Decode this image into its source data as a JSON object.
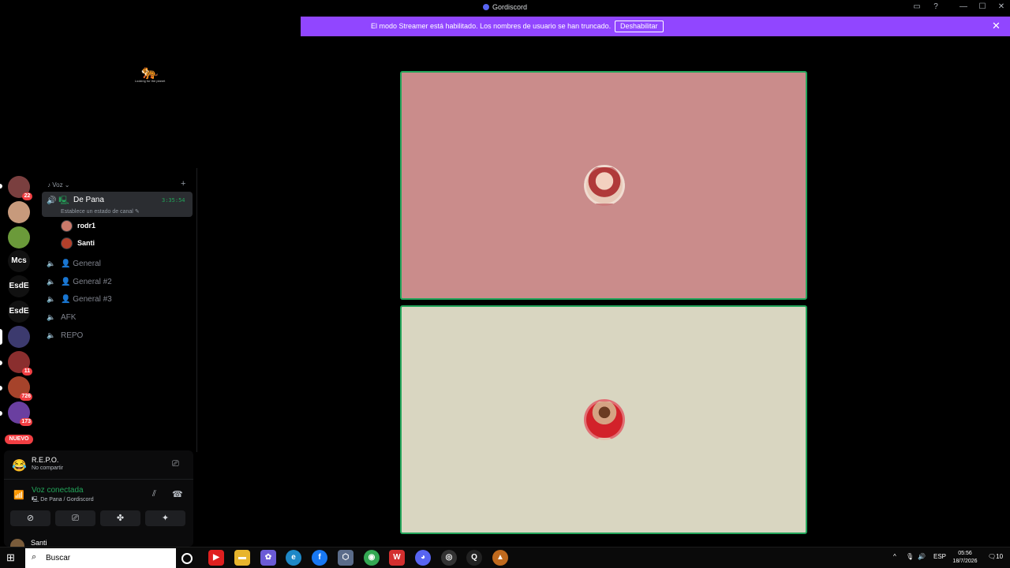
{
  "window": {
    "title": "Gordiscord"
  },
  "streamer_banner": {
    "message": "El modo Streamer está habilitado. Los nombres de usuario se han truncado.",
    "button": "Deshabilitar",
    "close": "✕"
  },
  "server_banner": {
    "tagline": "Looking for the planet"
  },
  "guilds": [
    {
      "label": "",
      "badge": "22",
      "color": "#7a3f3f"
    },
    {
      "label": "",
      "badge": "",
      "color": "#c79a7c"
    },
    {
      "label": "",
      "badge": "",
      "color": "#6b9a3a"
    },
    {
      "label": "Mcs",
      "badge": ""
    },
    {
      "label": "EsdE",
      "badge": ""
    },
    {
      "label": "EsdE",
      "badge": ""
    },
    {
      "label": "",
      "badge": "",
      "color": "#3c3a6e"
    },
    {
      "label": "",
      "badge": "11",
      "color": "#8a2e2e"
    },
    {
      "label": "",
      "badge": "726",
      "color": "#a6432b"
    },
    {
      "label": "",
      "badge": "173",
      "color": "#6a3fa0"
    }
  ],
  "nuevo_badge": "NUEVO",
  "channels": {
    "category": "Voz",
    "active": {
      "name": "De Pana",
      "time": "3:35:54",
      "status": "Establece un estado de canal"
    },
    "members": [
      {
        "name": "rodr1",
        "color": "#c97a6b"
      },
      {
        "name": "Santi",
        "color": "#b3402b"
      }
    ],
    "list": [
      {
        "name": "General"
      },
      {
        "name": "General #2"
      },
      {
        "name": "General #3"
      },
      {
        "name": "AFK"
      },
      {
        "name": "REPO"
      }
    ]
  },
  "panel": {
    "game_name": "R.E.P.O.",
    "game_status": "No compartir",
    "voice_title": "Voz conectada",
    "voice_sub": "De Pana / Gordiscord",
    "username": "Santi"
  },
  "taskbar": {
    "search_placeholder": "Buscar",
    "language": "ESP",
    "time": "05:56",
    "date": "18/7/2026",
    "notifications": "10"
  },
  "colors": {
    "streamer_purple": "#9146ff",
    "speaking_green": "#23a55a",
    "tile1_bg": "#ca8c8b",
    "tile2_bg": "#d9d6c1"
  }
}
